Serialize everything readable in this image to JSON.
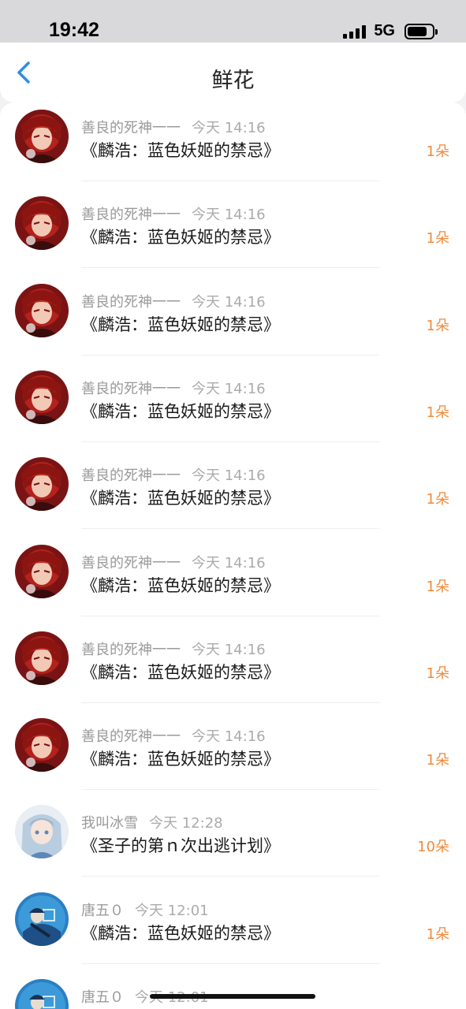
{
  "status_bar": {
    "time": "19:42",
    "network": "5G"
  },
  "nav": {
    "title": "鲜花",
    "back_icon": "chevron-left-icon"
  },
  "items": [
    {
      "user": "善良的死神一一",
      "time": "今天 14:16",
      "book": "《麟浩：蓝色妖姬的禁忌》",
      "count": "1朵",
      "avatar": "red"
    },
    {
      "user": "善良的死神一一",
      "time": "今天 14:16",
      "book": "《麟浩：蓝色妖姬的禁忌》",
      "count": "1朵",
      "avatar": "red"
    },
    {
      "user": "善良的死神一一",
      "time": "今天 14:16",
      "book": "《麟浩：蓝色妖姬的禁忌》",
      "count": "1朵",
      "avatar": "red"
    },
    {
      "user": "善良的死神一一",
      "time": "今天 14:16",
      "book": "《麟浩：蓝色妖姬的禁忌》",
      "count": "1朵",
      "avatar": "red"
    },
    {
      "user": "善良的死神一一",
      "time": "今天 14:16",
      "book": "《麟浩：蓝色妖姬的禁忌》",
      "count": "1朵",
      "avatar": "red"
    },
    {
      "user": "善良的死神一一",
      "time": "今天 14:16",
      "book": "《麟浩：蓝色妖姬的禁忌》",
      "count": "1朵",
      "avatar": "red"
    },
    {
      "user": "善良的死神一一",
      "time": "今天 14:16",
      "book": "《麟浩：蓝色妖姬的禁忌》",
      "count": "1朵",
      "avatar": "red"
    },
    {
      "user": "善良的死神一一",
      "time": "今天 14:16",
      "book": "《麟浩：蓝色妖姬的禁忌》",
      "count": "1朵",
      "avatar": "red"
    },
    {
      "user": "我叫冰雪",
      "time": "今天 12:28",
      "book": "《圣子的第ｎ次出逃计划》",
      "count": "10朵",
      "avatar": "light"
    },
    {
      "user": "唐五０",
      "time": "今天 12:01",
      "book": "《麟浩：蓝色妖姬的禁忌》",
      "count": "1朵",
      "avatar": "blue"
    },
    {
      "user": "唐五０",
      "time": "今天 12:01",
      "book": "",
      "count": "",
      "avatar": "blue"
    }
  ],
  "colors": {
    "accent": "#f08a3a",
    "back": "#2f8fe0"
  }
}
